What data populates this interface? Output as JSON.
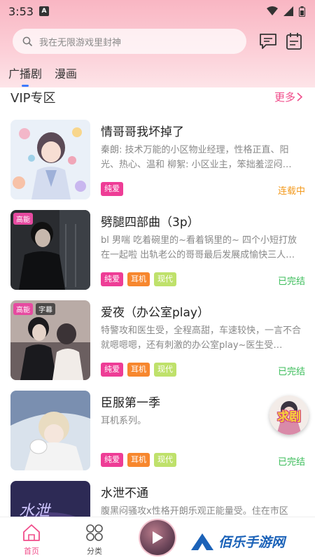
{
  "status_bar": {
    "time": "3:53",
    "indicator": "A"
  },
  "search": {
    "placeholder": "我在无限游戏里封神"
  },
  "icons": {
    "message": "message-icon",
    "calendar": "calendar-icon",
    "search": "search-icon"
  },
  "tabs": [
    {
      "label": "广播剧",
      "active": true
    },
    {
      "label": "漫画",
      "active": false
    }
  ],
  "section": {
    "title": "VIP专区",
    "more": "更多"
  },
  "items": [
    {
      "title": "情哥哥我坏掉了",
      "desc": "秦朗: 技术万能的小区物业经理，性格正直、阳光、热心、温和 柳絮: 小区业主，笨拙羞涩闷…",
      "tags": [
        {
          "label": "纯爱",
          "color": "pink"
        }
      ],
      "status": "连载中",
      "badges": []
    },
    {
      "title": "劈腿四部曲（3p）",
      "desc": "bl 男喘 吃着碗里的~看着锅里的~ 四个小短打放在一起啦 出轨老公的哥哥最后发展成愉快三人…",
      "tags": [
        {
          "label": "纯爱",
          "color": "pink"
        },
        {
          "label": "耳机",
          "color": "orange"
        },
        {
          "label": "现代",
          "color": "green"
        }
      ],
      "status": "已完结",
      "badges": [
        "高能"
      ]
    },
    {
      "title": "爱夜（办公室play）",
      "desc": "特警攻和医生受，全程高甜，车速较快，一言不合就嗯嗯嗯，还有刺激的办公室play~医生受…",
      "tags": [
        {
          "label": "纯爱",
          "color": "pink"
        },
        {
          "label": "耳机",
          "color": "orange"
        },
        {
          "label": "现代",
          "color": "green"
        }
      ],
      "status": "已完结",
      "badges": [
        "高能",
        "字幕"
      ]
    },
    {
      "title": "臣服第一季",
      "desc": "耳机系列。",
      "tags": [
        {
          "label": "纯爱",
          "color": "pink"
        },
        {
          "label": "耳机",
          "color": "orange"
        },
        {
          "label": "现代",
          "color": "green"
        }
      ],
      "status": "已完结",
      "badges": []
    },
    {
      "title": "水泄不通",
      "desc": "腹黑闷骚攻x性格开朗乐观正能量受。住在市区",
      "tags": [],
      "status": "",
      "badges": []
    }
  ],
  "float_button": {
    "label": "求剧"
  },
  "nav": {
    "home": "首页",
    "category": "分类"
  },
  "watermark": {
    "text": "佰乐手游网"
  },
  "colors": {
    "accent": "#f04c8a",
    "header": "#f9b6c3",
    "tab_indicator": "#3d7bff"
  }
}
